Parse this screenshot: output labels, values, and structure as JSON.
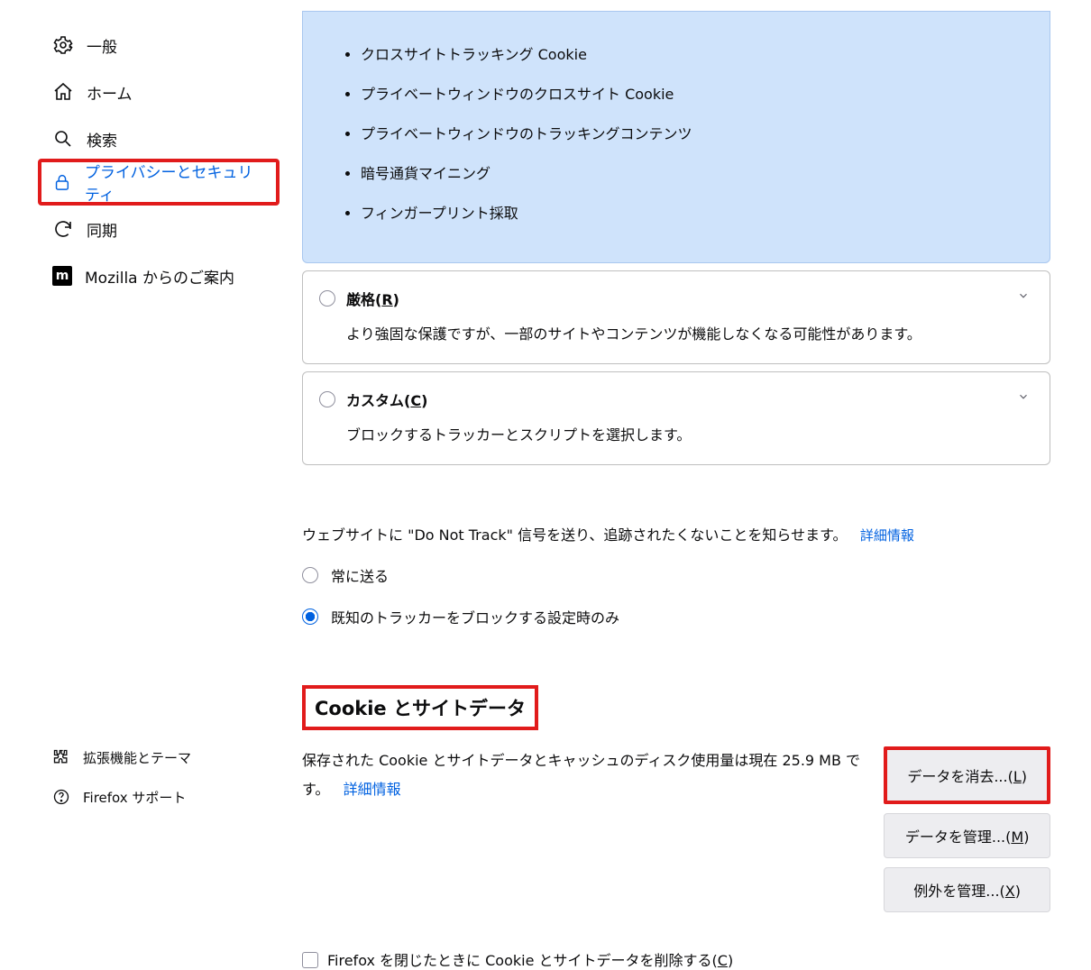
{
  "sidebar": {
    "general": "一般",
    "home": "ホーム",
    "search": "検索",
    "privacy": "プライバシーとセキュリティ",
    "sync": "同期",
    "mozilla": "Mozilla からのご案内"
  },
  "sidebar_bottom": {
    "extensions": "拡張機能とテーマ",
    "support": "Firefox サポート"
  },
  "blocked_items": [
    "クロスサイトトラッキング Cookie",
    "プライベートウィンドウのクロスサイト Cookie",
    "プライベートウィンドウのトラッキングコンテンツ",
    "暗号通貨マイニング",
    "フィンガープリント採取"
  ],
  "strict": {
    "title_pre": "厳格(",
    "title_key": "R",
    "title_post": ")",
    "desc": "より強固な保護ですが、一部のサイトやコンテンツが機能しなくなる可能性があります。"
  },
  "custom": {
    "title_pre": "カスタム(",
    "title_key": "C",
    "title_post": ")",
    "desc": "ブロックするトラッカーとスクリプトを選択します。"
  },
  "dnt": {
    "text": "ウェブサイトに \"Do Not Track\" 信号を送り、追跡されたくないことを知らせます。",
    "more": "詳細情報",
    "always": "常に送る",
    "only_trackers": "既知のトラッカーをブロックする設定時のみ"
  },
  "cookie": {
    "heading": "Cookie とサイトデータ",
    "body_pre": "保存された Cookie とサイトデータとキャッシュのディスク使用量は現在 ",
    "body_size": "25.9 MB",
    "body_post": " です。",
    "more": "詳細情報",
    "delete_on_close_pre": "Firefox を閉じたときに Cookie とサイトデータを削除する(",
    "delete_on_close_key": "C",
    "delete_on_close_post": ")",
    "btn_clear_pre": "データを消去...(",
    "btn_clear_key": "L",
    "btn_clear_post": ")",
    "btn_manage_pre": "データを管理...(",
    "btn_manage_key": "M",
    "btn_manage_post": ")",
    "btn_except_pre": "例外を管理...(",
    "btn_except_key": "X",
    "btn_except_post": ")"
  }
}
